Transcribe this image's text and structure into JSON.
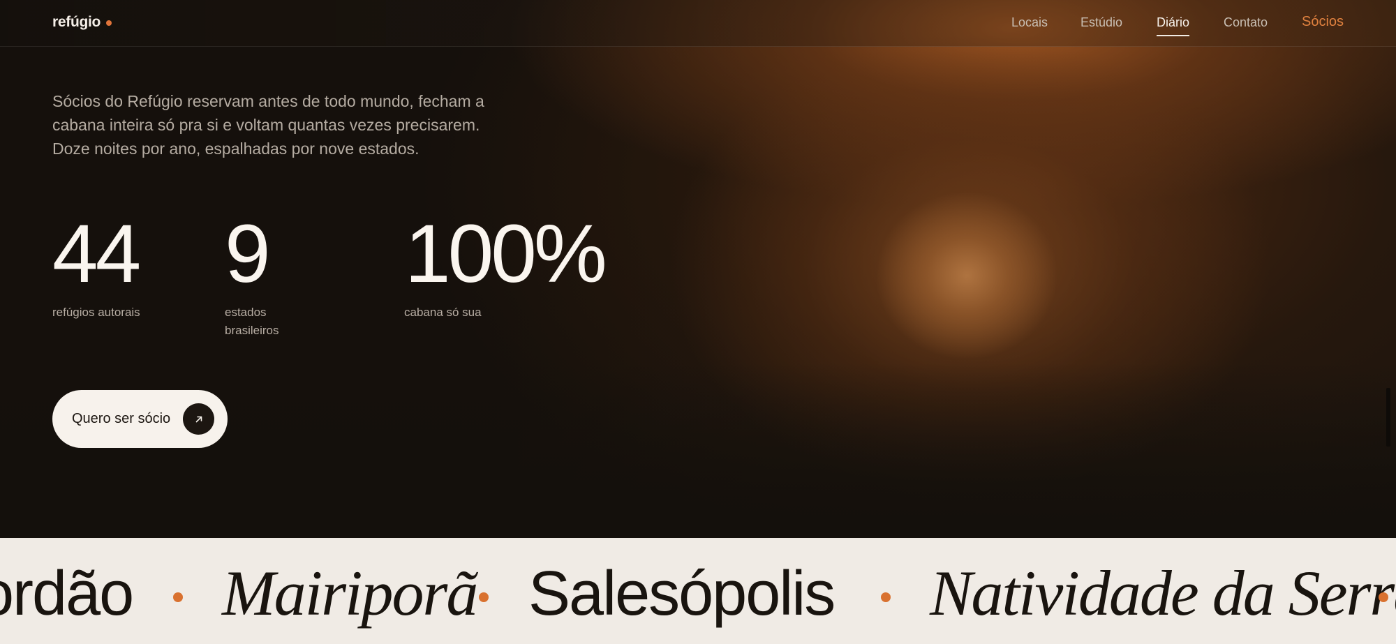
{
  "brand": {
    "name": "refúgio",
    "accent_color": "#e0743a"
  },
  "nav": {
    "links": [
      {
        "label": "Locais"
      },
      {
        "label": "Estúdio"
      },
      {
        "label": "Diário",
        "active": true
      },
      {
        "label": "Contato"
      }
    ],
    "cta": "Sócios"
  },
  "hero": {
    "intro": "Sócios do Refúgio reservam antes de todo mundo, fecham a cabana inteira só pra si e voltam quantas vezes precisarem. Doze noites por ano, espalhadas por nove estados.",
    "stats": [
      {
        "value": "44",
        "label": "refúgios autorais"
      },
      {
        "value": "9",
        "label": "estados brasileiros"
      },
      {
        "value": "100%",
        "label": "cabana só sua"
      }
    ],
    "button": {
      "label": "Quero ser sócio",
      "icon": "arrow-up-right-icon"
    }
  },
  "marquee": {
    "row1": [
      "ordão",
      "Mairiporã",
      "Salesópolis",
      "Natividade da Serra"
    ]
  },
  "colors": {
    "background": "#14100c",
    "cream": "#f0ebe5",
    "accent": "#d9712f"
  }
}
